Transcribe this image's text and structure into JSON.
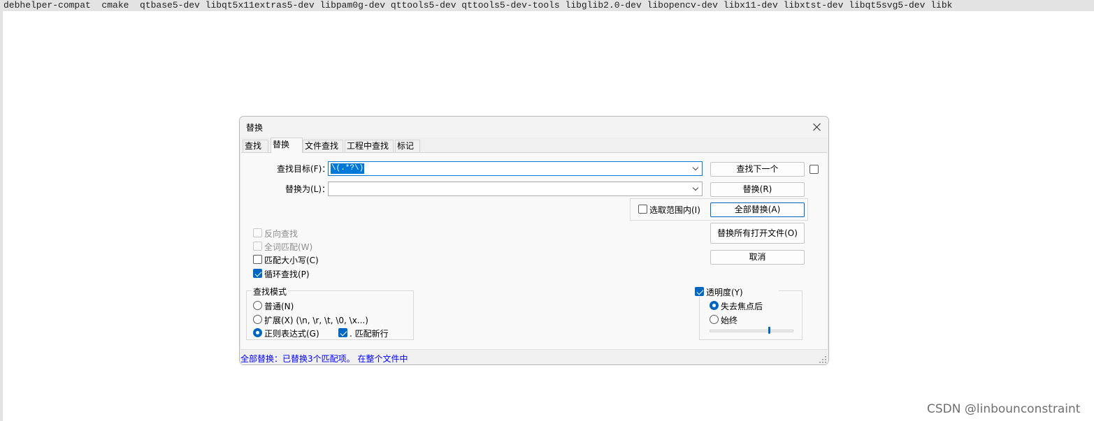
{
  "top_bar": {
    "packages": "debhelper-compat  cmake  qtbase5-dev libqt5x11extras5-dev libpam0g-dev qttools5-dev qttools5-dev-tools libglib2.0-dev libopencv-dev libx11-dev libxtst-dev libqt5svg5-dev libk"
  },
  "dialog": {
    "title": "替换",
    "tabs": [
      {
        "label": "查找",
        "active": false
      },
      {
        "label": "替换",
        "active": true
      },
      {
        "label": "文件查找",
        "active": false
      },
      {
        "label": "工程中查找",
        "active": false
      },
      {
        "label": "标记",
        "active": false
      }
    ],
    "find_label": "查找目标(F)：",
    "find_value": "\\(.*?\\)",
    "replace_label": "替换为(L)：",
    "replace_value": "",
    "buttons": {
      "find_next": "查找下一个",
      "replace": "替换(R)",
      "replace_all": "全部替换(A)",
      "replace_all_open": "替换所有打开文件(O)",
      "cancel": "取消"
    },
    "in_selection": {
      "label": "选取范围内(I)",
      "checked": false
    },
    "options": [
      {
        "label": "反向查找",
        "checked": false,
        "disabled": true
      },
      {
        "label": "全词匹配(W)",
        "checked": false,
        "disabled": true
      },
      {
        "label": "匹配大小写(C)",
        "checked": false,
        "disabled": false
      },
      {
        "label": "循环查找(P)",
        "checked": true,
        "disabled": false
      }
    ],
    "search_mode": {
      "title": "查找模式",
      "normal": "普通(N)",
      "extended": "扩展(X) (\\n, \\r, \\t, \\0, \\x...)",
      "regex": "正则表达式(G)",
      "selected": "regex",
      "dot_matches_newline": {
        "label": ". 匹配新行",
        "checked": true
      }
    },
    "transparency": {
      "label": "透明度(Y)",
      "checked": true,
      "on_lose_focus": "失去焦点后",
      "always": "始终",
      "selected": "on_lose_focus",
      "level": 0.72
    },
    "status": "全部替换：已替换3个匹配项。 在整个文件中"
  },
  "watermark": "CSDN @linbounconstraint",
  "colors": {
    "accent": "#0067c0",
    "status_text": "#0000ff",
    "selection": "#0078d7"
  }
}
